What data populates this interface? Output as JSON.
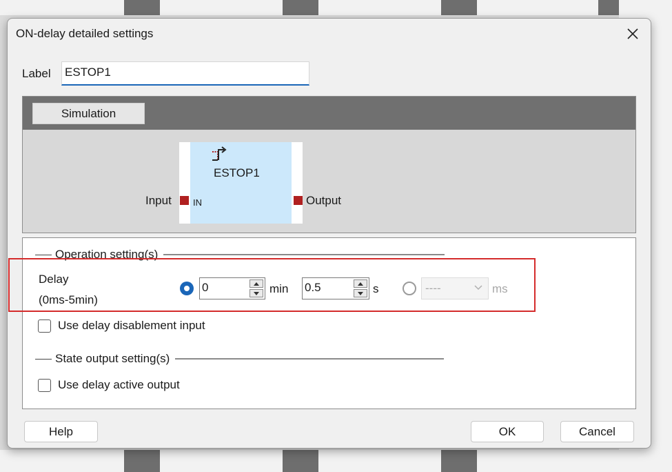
{
  "dialog": {
    "title": "ON-delay detailed settings",
    "label_caption": "Label",
    "label_value": "ESTOP1"
  },
  "simulation": {
    "tab_label": "Simulation",
    "block_name": "ESTOP1",
    "pin_in_label": "IN",
    "input_label": "Input",
    "output_label": "Output",
    "block_icon": "on-delay-icon"
  },
  "operation": {
    "section_title": "Operation setting(s)",
    "delay_label": "Delay",
    "delay_range": "(0ms-5min)",
    "min_value": "0",
    "min_unit": "min",
    "sec_value": "0.5",
    "sec_unit": "s",
    "ms_value": "----",
    "ms_unit": "ms",
    "delay_mode_selected": "min-s",
    "use_delay_disablement_label": "Use delay disablement input",
    "use_delay_disablement_checked": false
  },
  "state_output": {
    "section_title": "State output setting(s)",
    "use_delay_active_label": "Use delay active output",
    "use_delay_active_checked": false
  },
  "buttons": {
    "help": "Help",
    "ok": "OK",
    "cancel": "Cancel"
  },
  "colors": {
    "accent": "#1a66b8",
    "pin": "#b02020",
    "highlight": "#d42a2a",
    "block_fill": "#cce8fb"
  }
}
